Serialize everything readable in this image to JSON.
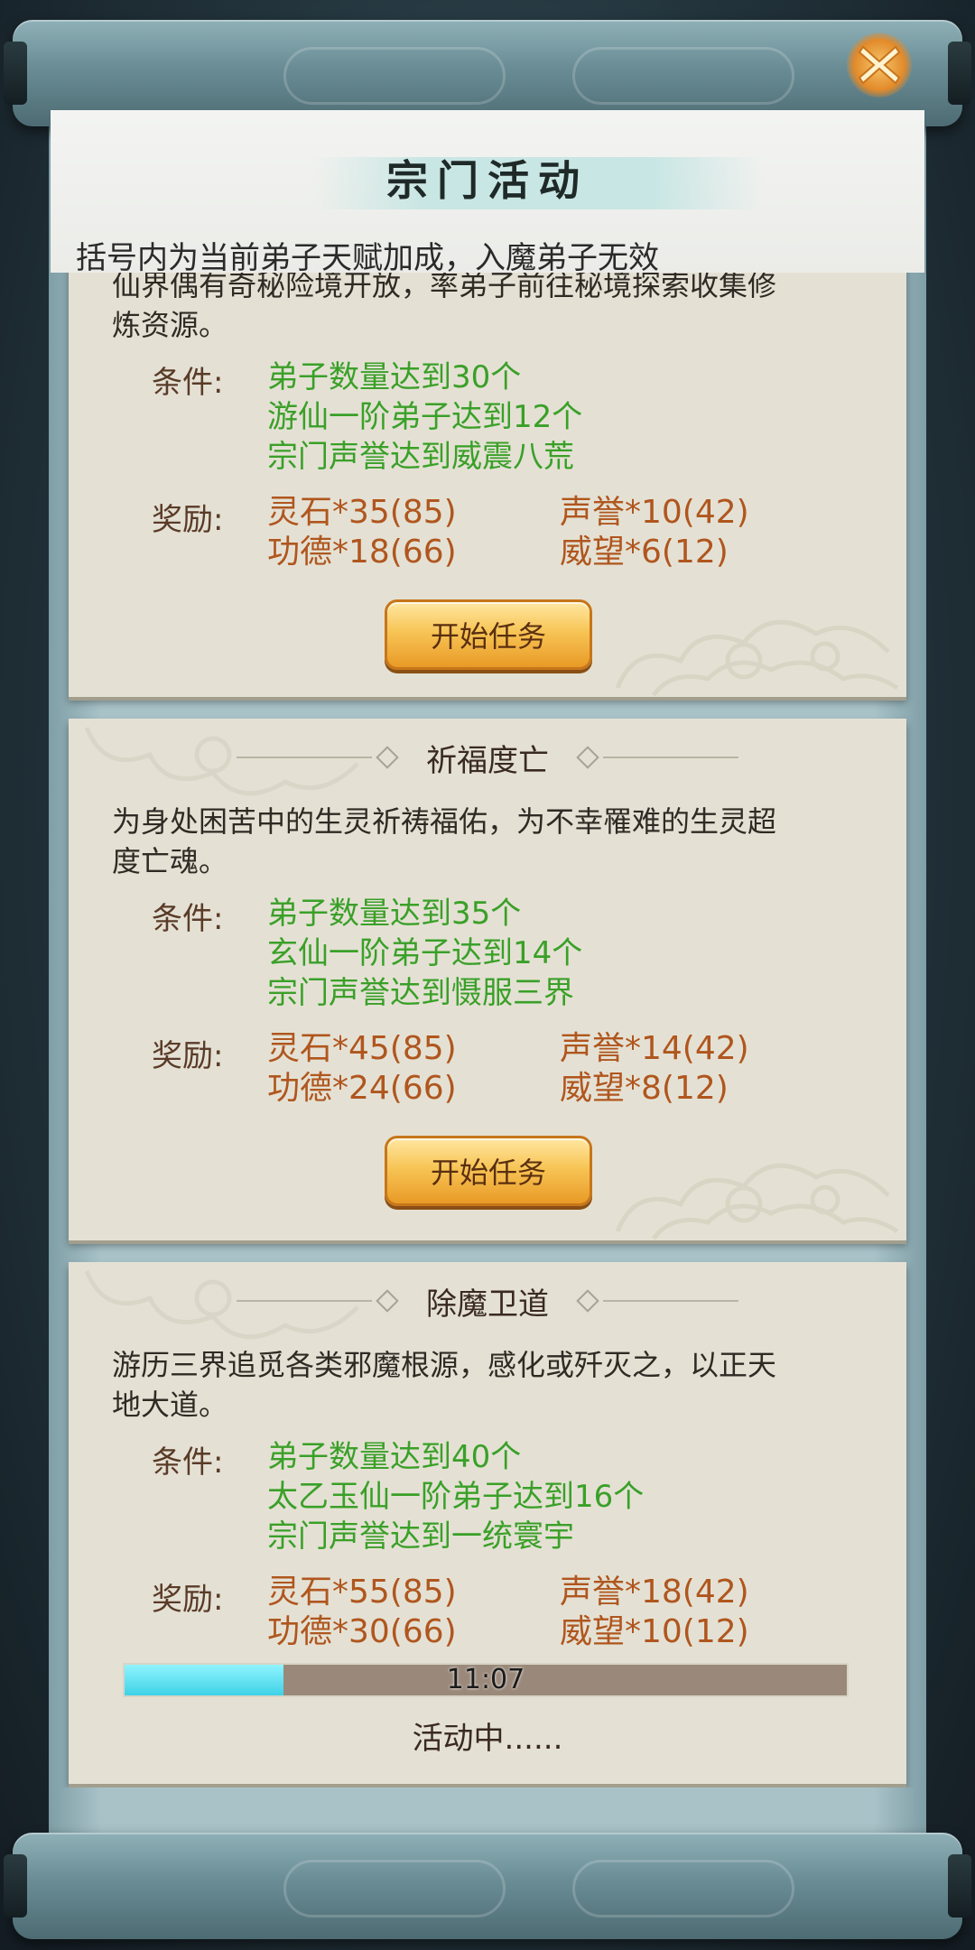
{
  "header": {
    "title": "宗门活动",
    "subtitle": "括号内为当前弟子天赋加成，入魔弟子无效"
  },
  "labels": {
    "condition": "条件:",
    "reward": "奖励:"
  },
  "cards": [
    {
      "title": "",
      "desc": "仙界偶有奇秘险境开放，率弟子前往秘境探索收集修炼资源。",
      "desc_line1": "仙界偶有奇秘险境开放，率弟子前往秘境探索收集修",
      "desc_line2": "炼资源。",
      "conditions": [
        "弟子数量达到30个",
        "游仙一阶弟子达到12个",
        "宗门声誉达到威震八荒"
      ],
      "rewards": [
        "灵石*35(85)",
        "声誉*10(42)",
        "功德*18(66)",
        "威望*6(12)"
      ],
      "button": "开始任务"
    },
    {
      "title": "祈福度亡",
      "desc_line1": "为身处困苦中的生灵祈祷福佑，为不幸罹难的生灵超",
      "desc_line2": "度亡魂。",
      "conditions": [
        "弟子数量达到35个",
        "玄仙一阶弟子达到14个",
        "宗门声誉达到慑服三界"
      ],
      "rewards": [
        "灵石*45(85)",
        "声誉*14(42)",
        "功德*24(66)",
        "威望*8(12)"
      ],
      "button": "开始任务"
    },
    {
      "title": "除魔卫道",
      "desc_line1": "游历三界追觅各类邪魔根源，感化或歼灭之，以正天",
      "desc_line2": "地大道。",
      "conditions": [
        "弟子数量达到40个",
        "太乙玉仙一阶弟子达到16个",
        "宗门声誉达到一统寰宇"
      ],
      "rewards": [
        "灵石*55(85)",
        "声誉*18(42)",
        "功德*30(66)",
        "威望*10(12)"
      ],
      "progress": {
        "fraction": 0.22,
        "time": "11:07"
      },
      "status": "活动中......"
    }
  ],
  "colors": {
    "condition": "#3aa028",
    "reward": "#b0561e",
    "card_bg": "#e4e1d4",
    "button": "#f7c556",
    "progress_fill": "#3fd2e6"
  },
  "icons": {
    "close": "close-x-icon"
  }
}
